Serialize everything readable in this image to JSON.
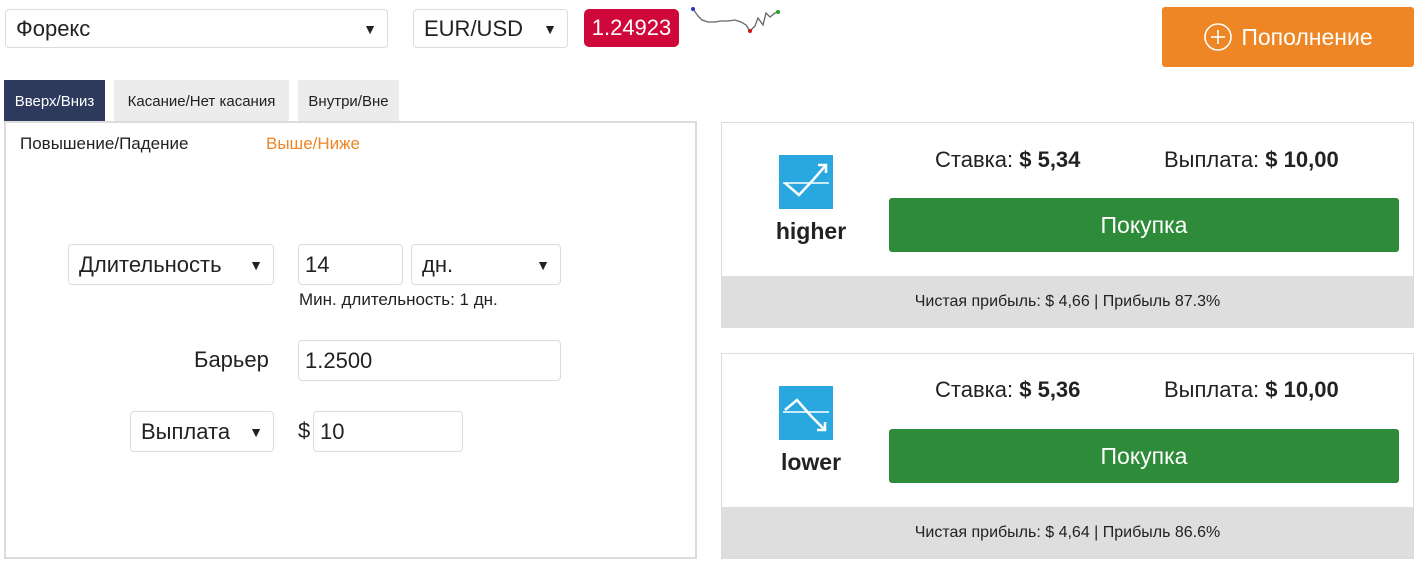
{
  "top": {
    "market_select": "Форекс",
    "pair_select": "EUR/USD",
    "price": "1.24923",
    "deposit_button": "Пополнение",
    "colors": {
      "price_bg": "#d0073b",
      "deposit_bg": "#ee8626"
    }
  },
  "tabs": [
    {
      "label": "Вверх/Вниз",
      "active": true
    },
    {
      "label": "Касание/Нет касания",
      "active": false
    },
    {
      "label": "Внутри/Вне",
      "active": false
    }
  ],
  "subtabs": [
    {
      "label": "Повышение/Падение",
      "active": false
    },
    {
      "label": "Выше/Ниже",
      "active": true
    }
  ],
  "form": {
    "duration_select": "Длительность",
    "duration_value": "14",
    "duration_unit": "дн.",
    "min_duration_note": "Мин. длительность: 1 дн.",
    "barrier_label": "Барьер",
    "barrier_value": "1.2500",
    "payout_select": "Выплата",
    "currency_symbol": "$",
    "payout_value": "10"
  },
  "contracts": [
    {
      "direction": "higher",
      "icon": "trend-up-icon",
      "stake_label": "Ставка:",
      "stake_value": "$ 5,34",
      "payout_label": "Выплата:",
      "payout_value": "$ 10,00",
      "buy_label": "Покупка",
      "footer": "Чистая прибыль: $ 4,66 | Прибыль 87.3%"
    },
    {
      "direction": "lower",
      "icon": "trend-down-icon",
      "stake_label": "Ставка:",
      "stake_value": "$ 5,36",
      "payout_label": "Выплата:",
      "payout_value": "$ 10,00",
      "buy_label": "Покупка",
      "footer": "Чистая прибыль: $ 4,64 | Прибыль 86.6%"
    }
  ]
}
